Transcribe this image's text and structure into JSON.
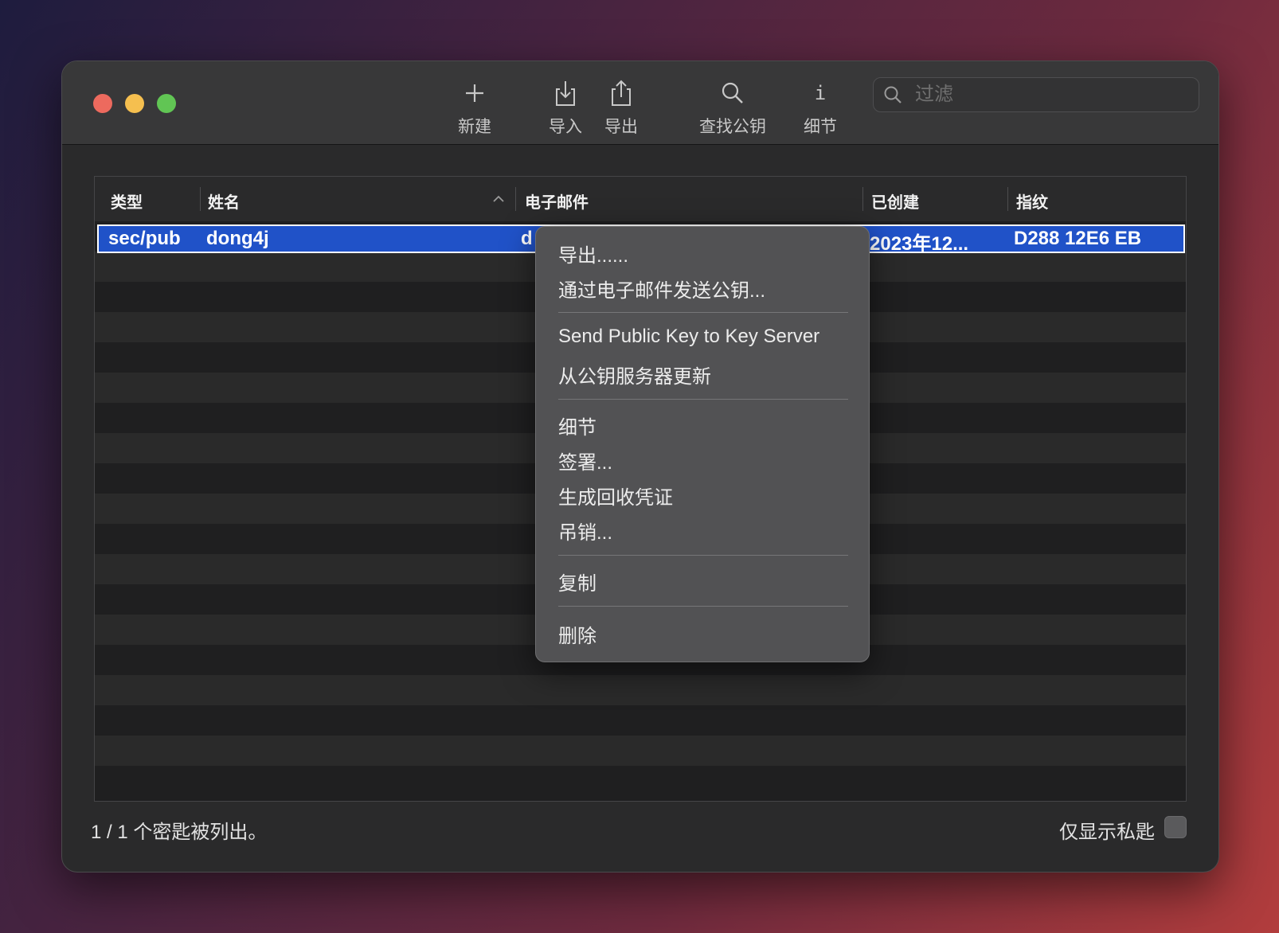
{
  "toolbar": {
    "new_label": "新建",
    "import_label": "导入",
    "export_label": "导出",
    "lookup_label": "查找公钥",
    "details_label": "细节",
    "details_glyph": "i",
    "search_placeholder": "过滤"
  },
  "table": {
    "columns": {
      "type": "类型",
      "name": "姓名",
      "email": "电子邮件",
      "created": "已创建",
      "fingerprint": "指纹"
    },
    "rows": [
      {
        "type": "sec/pub",
        "name": "dong4j",
        "email": "d",
        "created": "2023年12...",
        "fingerprint": "D288  12E6  EB"
      }
    ]
  },
  "context_menu": {
    "export": "导出......",
    "email_public_key": "通过电子邮件发送公钥...",
    "send_to_server": "Send Public Key to Key Server",
    "update_from_server": "从公钥服务器更新",
    "details": "细节",
    "sign": "签署...",
    "revocation_cert": "生成回收凭证",
    "revoke": "吊销...",
    "copy": "复制",
    "delete": "删除"
  },
  "footer": {
    "status": "1 / 1 个密匙被列出。",
    "private_only_label": "仅显示私匙",
    "private_only_checked": false
  },
  "colors": {
    "selection": "#2052c8",
    "close": "#ed6a5e",
    "minimize": "#f5bf4f",
    "zoom": "#61c554"
  }
}
